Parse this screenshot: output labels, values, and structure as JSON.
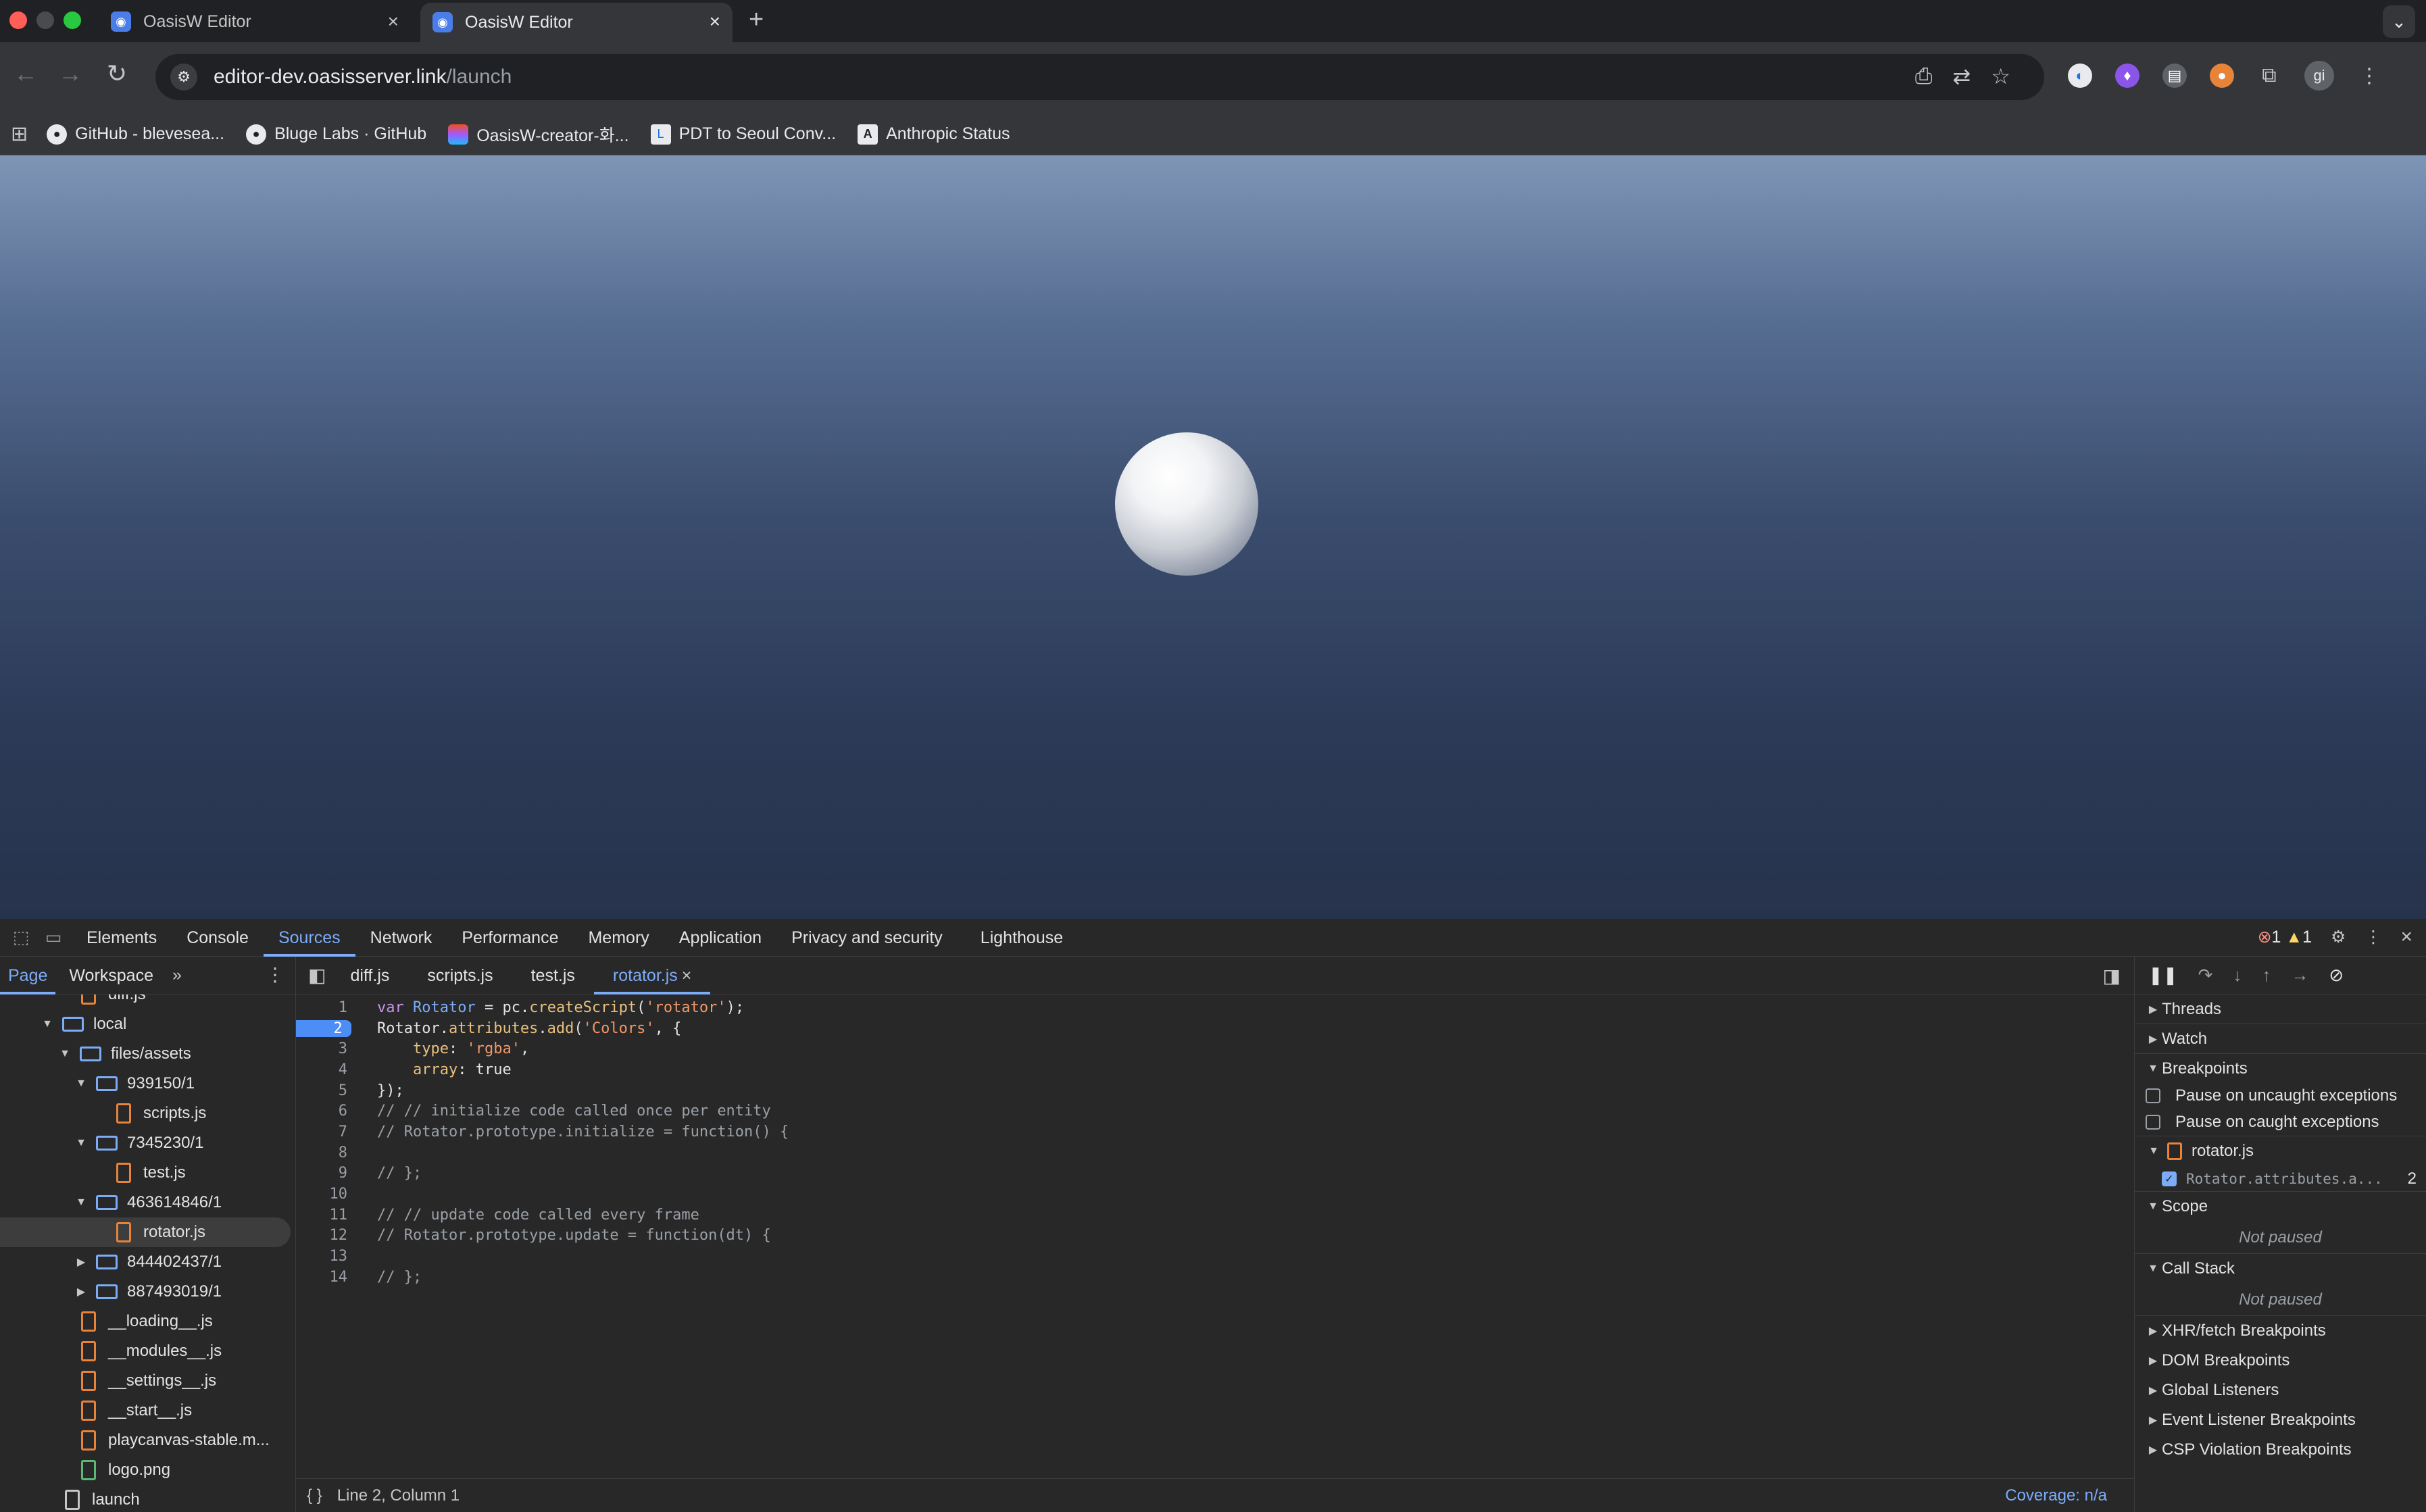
{
  "browser": {
    "tabs": [
      {
        "title": "OasisW Editor",
        "active": false
      },
      {
        "title": "OasisW Editor",
        "active": true
      }
    ],
    "url_host": "editor-dev.oasisserver.link",
    "url_path": "/launch",
    "profile_initials": "gi",
    "bookmarks": [
      {
        "label": "GitHub - blevesea...",
        "icon": "github-icon"
      },
      {
        "label": "Bluge Labs · GitHub",
        "icon": "github-icon"
      },
      {
        "label": "OasisW-creator-화...",
        "icon": "figma-icon"
      },
      {
        "label": "PDT to Seoul Conv...",
        "icon": "time-icon"
      },
      {
        "label": "Anthropic Status",
        "icon": "anthropic-icon"
      }
    ]
  },
  "devtools": {
    "tabs": [
      "Elements",
      "Console",
      "Sources",
      "Network",
      "Performance",
      "Memory",
      "Application",
      "Privacy and security",
      "Lighthouse"
    ],
    "selected_tab": "Sources",
    "error_count": "1",
    "warning_count": "1",
    "navigator": {
      "tabs": [
        "Page",
        "Workspace"
      ],
      "tree": [
        {
          "label": "diff.js",
          "depth": 3,
          "type": "file",
          "partial": true
        },
        {
          "label": "local",
          "depth": 1,
          "type": "folder",
          "expanded": true
        },
        {
          "label": "files/assets",
          "depth": 2,
          "type": "folder",
          "expanded": true
        },
        {
          "label": "939150/1",
          "depth": 3,
          "type": "folder",
          "expanded": true
        },
        {
          "label": "scripts.js",
          "depth": 4,
          "type": "file"
        },
        {
          "label": "7345230/1",
          "depth": 3,
          "type": "folder",
          "expanded": true
        },
        {
          "label": "test.js",
          "depth": 4,
          "type": "file"
        },
        {
          "label": "463614846/1",
          "depth": 3,
          "type": "folder",
          "expanded": true
        },
        {
          "label": "rotator.js",
          "depth": 4,
          "type": "file",
          "selected": true
        },
        {
          "label": "844402437/1",
          "depth": 3,
          "type": "folder",
          "expanded": false
        },
        {
          "label": "887493019/1",
          "depth": 3,
          "type": "folder",
          "expanded": false
        },
        {
          "label": "__loading__.js",
          "depth": 3,
          "type": "file"
        },
        {
          "label": "__modules__.js",
          "depth": 3,
          "type": "file"
        },
        {
          "label": "__settings__.js",
          "depth": 3,
          "type": "file"
        },
        {
          "label": "__start__.js",
          "depth": 3,
          "type": "file"
        },
        {
          "label": "playcanvas-stable.m...",
          "depth": 3,
          "type": "file"
        },
        {
          "label": "logo.png",
          "depth": 3,
          "type": "image"
        },
        {
          "label": "launch",
          "depth": 2,
          "type": "doc"
        }
      ]
    },
    "editor": {
      "tabs": [
        "diff.js",
        "scripts.js",
        "test.js",
        "rotator.js"
      ],
      "selected_tab": "rotator.js",
      "breakpoint_line": 2,
      "status_position": "Line 2, Column 1",
      "coverage": "Coverage: n/a"
    },
    "sidebar": {
      "threads": "Threads",
      "watch": "Watch",
      "breakpoints": "Breakpoints",
      "pause_uncaught": "Pause on uncaught exceptions",
      "pause_caught": "Pause on caught exceptions",
      "bp_file": "rotator.js",
      "bp_entry": "Rotator.attributes.a...",
      "bp_line": "2",
      "scope": "Scope",
      "scope_status": "Not paused",
      "call_stack": "Call Stack",
      "call_stack_status": "Not paused",
      "more_sections": [
        "XHR/fetch Breakpoints",
        "DOM Breakpoints",
        "Global Listeners",
        "Event Listener Breakpoints",
        "CSP Violation Breakpoints"
      ]
    }
  }
}
